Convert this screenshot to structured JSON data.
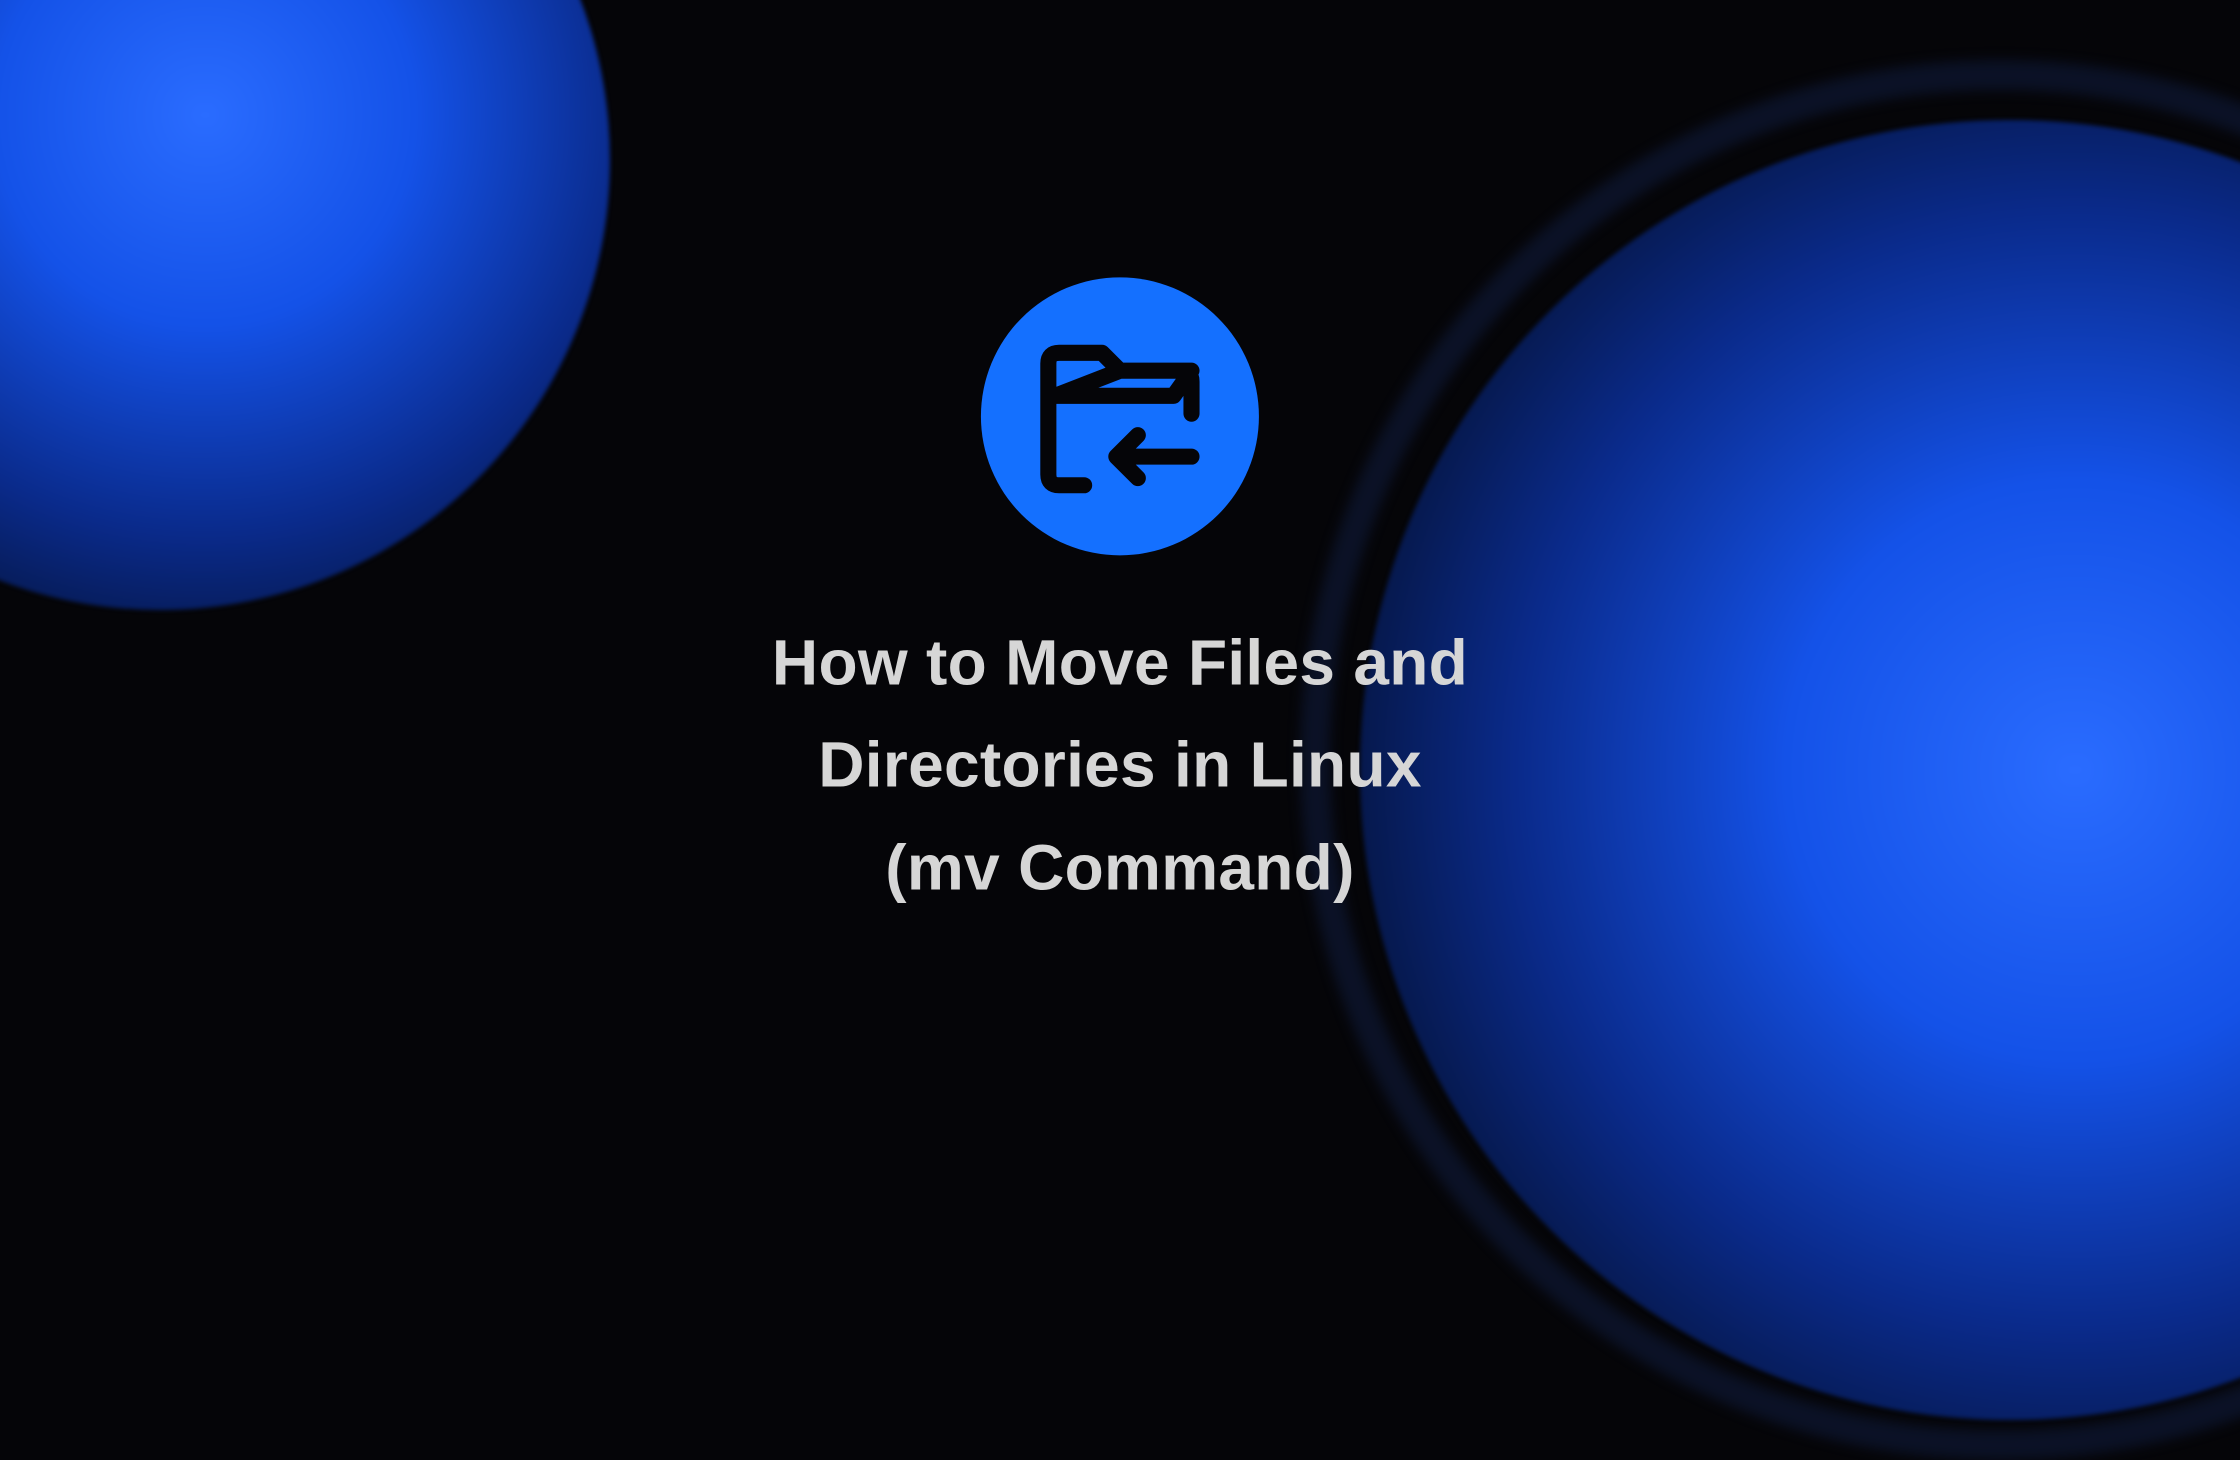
{
  "title": {
    "line1": "How to Move Files and",
    "line2": "Directories in Linux",
    "line3": "(mv Command)"
  },
  "icon": {
    "name": "folder-move-icon"
  },
  "colors": {
    "accent": "#1470ff",
    "text": "#d6d6d6",
    "background": "#050508"
  }
}
